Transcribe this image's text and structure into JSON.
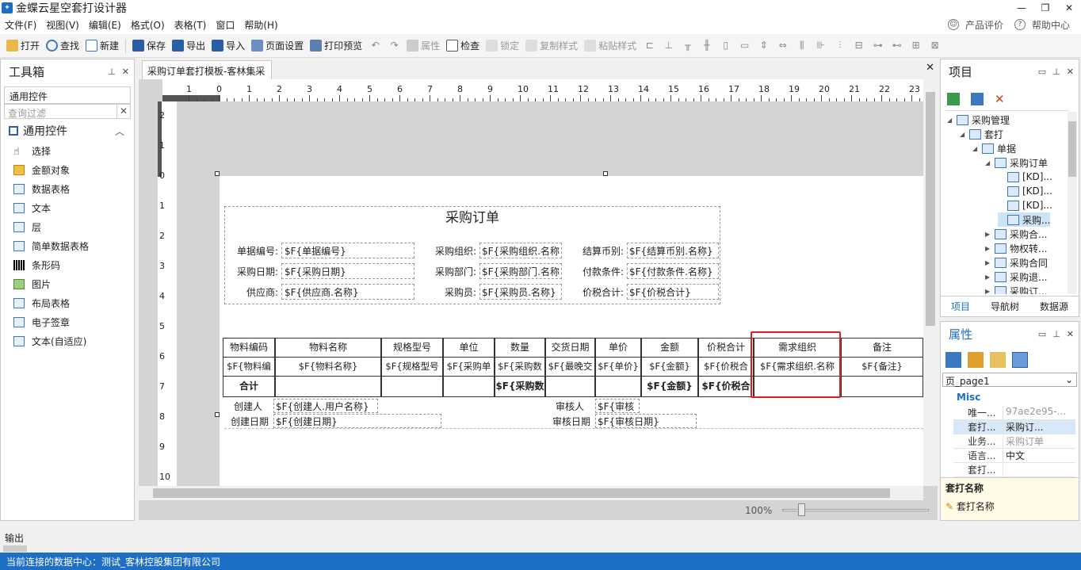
{
  "app": {
    "title": "金蝶云星空套打设计器"
  },
  "menu": [
    "文件(F)",
    "视图(V)",
    "编辑(E)",
    "格式(O)",
    "表格(T)",
    "窗口",
    "帮助(H)"
  ],
  "menu_right": {
    "rate": "产品评价",
    "help": "帮助中心"
  },
  "toolbar": {
    "open": "打开",
    "find": "查找",
    "new": "新建",
    "save": "保存",
    "export": "导出",
    "import": "导入",
    "page_setup": "页面设置",
    "print_preview": "打印预览",
    "properties": "属性",
    "check": "检查",
    "lock": "锁定",
    "copy_style": "复制样式",
    "paste_style": "粘贴样式"
  },
  "toolbox": {
    "title": "工具箱",
    "group": "通用控件",
    "filter_placeholder": "查询过滤",
    "section": "通用控件",
    "items": [
      "选择",
      "金额对象",
      "数据表格",
      "文本",
      "层",
      "简单数据表格",
      "条形码",
      "图片",
      "布局表格",
      "电子签章",
      "文本(自适应)"
    ]
  },
  "doc_tab": "采购订单套打模板-客林集采",
  "ruler": {
    "h": [
      "1",
      "0",
      "1",
      "2",
      "3",
      "4",
      "5",
      "6",
      "7",
      "8",
      "9",
      "10",
      "11",
      "12",
      "13",
      "14",
      "15",
      "16",
      "17",
      "18",
      "19",
      "20",
      "21",
      "22",
      "23"
    ],
    "v": [
      "2",
      "1",
      "0",
      "1",
      "2",
      "3",
      "4",
      "5",
      "6",
      "7",
      "8",
      "9",
      "10"
    ]
  },
  "form": {
    "title": "采购订单",
    "labels": {
      "billno": "单据编号:",
      "date": "采购日期:",
      "supplier": "供应商:",
      "org": "采购组织:",
      "dept": "采购部门:",
      "buyer": "采购员:",
      "currency": "结算币别:",
      "payterm": "付款条件:",
      "total": "价税合计:"
    },
    "values": {
      "billno": "$F{单据编号}",
      "date": "$F{采购日期}",
      "supplier": "$F{供应商.名称}",
      "org": "$F{采购组织.名称",
      "dept": "$F{采购部门.名称",
      "buyer": "$F{采购员.名称}",
      "currency": "$F{结算币别.名称}",
      "payterm": "$F{付款条件.名称}",
      "total": "$F{价税合计}"
    }
  },
  "table": {
    "headers": [
      "物料编码",
      "物料名称",
      "规格型号",
      "单位",
      "数量",
      "交货日期",
      "单价",
      "金额",
      "价税合计",
      "需求组织",
      "备注"
    ],
    "row": [
      "$F{物料编",
      "$F{物料名称}",
      "$F{规格型号",
      "$F{采购单",
      "$F{采购数",
      "$F{最晚交",
      "$F{单价}",
      "$F{金额}",
      "$F{价税合",
      "$F{需求组织.名称",
      "$F{备注}"
    ],
    "total_row": {
      "label": "合计",
      "qty": "$F{采购数",
      "amount": "$F{金额}",
      "tax": "$F{价税合"
    }
  },
  "footer": {
    "creator_label": "创建人",
    "creator": "$F{创建人.用户名称}",
    "auditor_label": "审核人",
    "auditor": "$F{审核",
    "cdate_label": "创建日期",
    "cdate": "$F{创建日期}",
    "adate_label": "审核日期",
    "adate": "$F{审核日期}"
  },
  "zoom": "100%",
  "project": {
    "title": "项目",
    "tree": [
      "采购管理",
      "套打",
      "单据",
      "采购订单",
      "[KD]...",
      "[KD]...",
      "[KD]...",
      "采购...",
      "采购合...",
      "物权转...",
      "采购合同",
      "采购退...",
      "采购订..."
    ],
    "tabs": [
      "项目",
      "导航树",
      "数据源"
    ]
  },
  "props": {
    "title": "属性",
    "selector": "页_page1",
    "category": "Misc",
    "rows": [
      {
        "k": "唯一...",
        "v": "97ae2e95-..."
      },
      {
        "k": "套打...",
        "v": "采购订..."
      },
      {
        "k": "业务...",
        "v": "采购订单"
      },
      {
        "k": "语言...",
        "v": "中文"
      },
      {
        "k": "套打...",
        "v": ""
      }
    ],
    "desc_title": "套打名称",
    "desc": "套打名称"
  },
  "output_label": "输出",
  "status": "当前连接的数据中心：测试_客林控股集团有限公司",
  "colors": {
    "accent": "#1c6fc4",
    "highlight": "#e02020"
  }
}
